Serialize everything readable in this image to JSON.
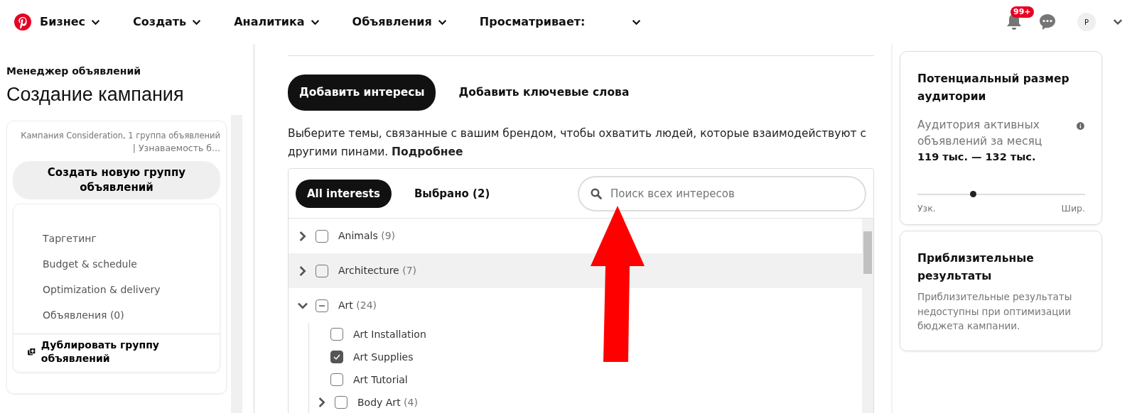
{
  "topnav": {
    "items": [
      {
        "label": "Бизнес"
      },
      {
        "label": "Создать"
      },
      {
        "label": "Аналитика"
      },
      {
        "label": "Объявления"
      },
      {
        "label": "Просматривает:"
      }
    ],
    "notifications_badge": "99+",
    "avatar": "P"
  },
  "sidebar": {
    "subtitle": "Менеджер объявлений",
    "title": "Создание кампания",
    "campaign": "Кампания Consideration, 1 группа объявлений",
    "campaign_goal": "| Узнаваемость б...",
    "create_button": "Создать новую группу объявлений",
    "steps": [
      {
        "label": "Таргетинг"
      },
      {
        "label": "Budget & schedule"
      },
      {
        "label": "Optimization & delivery"
      },
      {
        "label": "Объявления (0)"
      }
    ],
    "duplicate": "Дублировать группу объявлений"
  },
  "main": {
    "mode_tabs": [
      {
        "label": "Добавить интересы",
        "selected": true
      },
      {
        "label": "Добавить ключевые слова",
        "selected": false
      }
    ],
    "description": "Выберите темы, связанные с вашим брендом, чтобы охватить людей, которые взаимодействуют с другими пинами. **Подробнее**",
    "filter_tabs": [
      {
        "label": "All interests",
        "selected": true
      },
      {
        "label": "Выбрано (2)",
        "selected": false
      }
    ],
    "search": {
      "placeholder": "Поиск всех интересов"
    },
    "interests": [
      {
        "name": "Animals",
        "count": "(9)",
        "checked": false,
        "indeterminate": false,
        "expanded": false,
        "highlighted": false
      },
      {
        "name": "Architecture",
        "count": "(7)",
        "checked": false,
        "indeterminate": false,
        "expanded": false,
        "highlighted": true
      },
      {
        "name": "Art",
        "count": "(24)",
        "checked": false,
        "indeterminate": true,
        "expanded": true,
        "highlighted": false,
        "children": [
          {
            "name": "Art Installation",
            "checked": false,
            "highlighted": false
          },
          {
            "name": "Art Supplies",
            "checked": true,
            "highlighted": false
          },
          {
            "name": "Art Tutorial",
            "checked": false,
            "highlighted": false
          },
          {
            "name": "Body Art",
            "count": "(4)",
            "checked": false,
            "indeterminate": false,
            "expanded": false,
            "highlighted": false
          }
        ]
      }
    ]
  },
  "audience": {
    "title": "Потенциальный размер аудитории",
    "label": "Аудитория активных объявлений за месяц",
    "range": "119 тыс. — 132 тыс.",
    "level": 0.33,
    "min_label": "Узк.",
    "max_label": "Шир."
  },
  "results": {
    "title": "Приблизительные результаты",
    "text": "Приблизительные результаты недоступны при оптимизации бюджета кампании."
  }
}
